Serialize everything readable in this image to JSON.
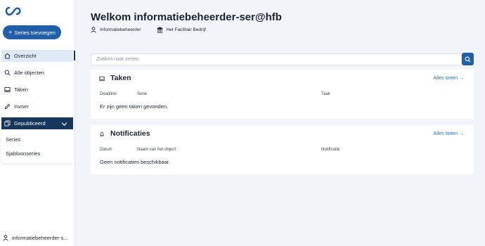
{
  "sidebar": {
    "add_button": "Series toevoegen",
    "items": [
      {
        "label": "Overzicht",
        "icon": "home-icon"
      },
      {
        "label": "Alle objecten",
        "icon": "search-icon"
      },
      {
        "label": "Taken",
        "icon": "inbox-icon"
      },
      {
        "label": "Invoer",
        "icon": "pencil-icon"
      },
      {
        "label": "Gepubliceerd",
        "icon": "copy-icon"
      }
    ],
    "sub_items": [
      "Series",
      "Sjabloonseries"
    ],
    "user": "informatiebeheerder-s..."
  },
  "header": {
    "title": "Welkom informatiebeheerder-ser@hfb",
    "role": "Informatiebeheerder",
    "organisation": "Het Facilitair Bedrijf"
  },
  "search": {
    "placeholder": "Zoeken naar series"
  },
  "tasks": {
    "title": "Taken",
    "show_all": "Alles tonen",
    "columns": [
      "Deadline",
      "Serie",
      "Taak"
    ],
    "empty": "Er zijn geen taken gevonden."
  },
  "notifications": {
    "title": "Notificaties",
    "show_all": "Alles tonen",
    "columns": [
      "Datum",
      "Naam van het object",
      "Notificatie"
    ],
    "empty": "Geen notificaties beschikbaar."
  },
  "colors": {
    "accent": "#2160a8",
    "nav_dark": "#17365c",
    "link": "#2a6fc0"
  }
}
